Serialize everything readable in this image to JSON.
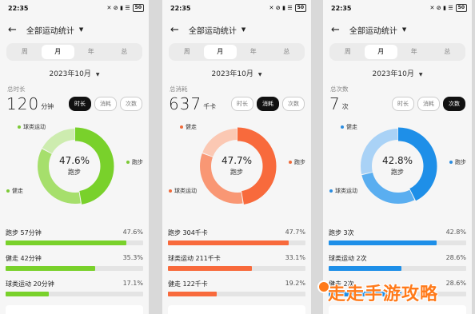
{
  "screens": [
    {
      "status": {
        "time": "22:35",
        "icons": "✕ ⊘ ▮ ☰",
        "battery": "50"
      },
      "header": {
        "title": "全部运动统计"
      },
      "periods": [
        "周",
        "月",
        "年",
        "总"
      ],
      "active_period": 1,
      "date": "2023年10月",
      "metric": {
        "label": "总时长",
        "value": "120",
        "unit": "分钟"
      },
      "toggles": [
        "时长",
        "消耗",
        "次数"
      ],
      "active_toggle": 0,
      "donut": {
        "center_pct": "47.6%",
        "center_label": "跑步"
      },
      "legend": [
        {
          "label": "球类运动",
          "side": "left"
        },
        {
          "label": "健走",
          "side": "left"
        },
        {
          "label": "跑步",
          "side": "right"
        }
      ],
      "colors": {
        "main": "#79d12b",
        "mid": "#a6df6c",
        "light": "#cdecaf",
        "dot": "#7cc936"
      },
      "chart_data": {
        "type": "pie",
        "slices": [
          {
            "name": "跑步",
            "value": 47.6
          },
          {
            "name": "健走",
            "value": 35.3
          },
          {
            "name": "球类运动",
            "value": 17.1
          }
        ]
      },
      "rows": [
        {
          "label": "跑步 57分钟",
          "value": "47.6%",
          "fraction": 0.476
        },
        {
          "label": "健走 42分钟",
          "value": "35.3%",
          "fraction": 0.353
        },
        {
          "label": "球类运动 20分钟",
          "value": "17.1%",
          "fraction": 0.171
        }
      ]
    },
    {
      "status": {
        "time": "22:35",
        "icons": "✕ ⊘ ▮ ☰",
        "battery": "50"
      },
      "header": {
        "title": "全部运动统计"
      },
      "periods": [
        "周",
        "月",
        "年",
        "总"
      ],
      "active_period": 1,
      "date": "2023年10月",
      "metric": {
        "label": "总消耗",
        "value": "637",
        "unit": "千卡"
      },
      "toggles": [
        "时长",
        "消耗",
        "次数"
      ],
      "active_toggle": 1,
      "donut": {
        "center_pct": "47.7%",
        "center_label": "跑步"
      },
      "legend": [
        {
          "label": "健走",
          "side": "left"
        },
        {
          "label": "球类运动",
          "side": "left"
        },
        {
          "label": "跑步",
          "side": "right"
        }
      ],
      "colors": {
        "main": "#f86a3c",
        "mid": "#f99774",
        "light": "#fbc8b3",
        "dot": "#ef6a3a"
      },
      "chart_data": {
        "type": "pie",
        "slices": [
          {
            "name": "跑步",
            "value": 47.7
          },
          {
            "name": "球类运动",
            "value": 33.1
          },
          {
            "name": "健走",
            "value": 19.2
          }
        ]
      },
      "rows": [
        {
          "label": "跑步 304千卡",
          "value": "47.7%",
          "fraction": 0.477
        },
        {
          "label": "球类运动 211千卡",
          "value": "33.1%",
          "fraction": 0.331
        },
        {
          "label": "健走 122千卡",
          "value": "19.2%",
          "fraction": 0.192
        }
      ]
    },
    {
      "status": {
        "time": "22:35",
        "icons": "✕ ⊘ ▮ ☰",
        "battery": "50"
      },
      "header": {
        "title": "全部运动统计"
      },
      "periods": [
        "周",
        "月",
        "年",
        "总"
      ],
      "active_period": 1,
      "date": "2023年10月",
      "metric": {
        "label": "总次数",
        "value": "7",
        "unit": "次"
      },
      "toggles": [
        "时长",
        "消耗",
        "次数"
      ],
      "active_toggle": 2,
      "donut": {
        "center_pct": "42.8%",
        "center_label": "跑步"
      },
      "legend": [
        {
          "label": "健走",
          "side": "left"
        },
        {
          "label": "球类运动",
          "side": "left"
        },
        {
          "label": "跑步",
          "side": "right"
        }
      ],
      "colors": {
        "main": "#1e8fe8",
        "mid": "#5aaef0",
        "light": "#a9d2f6",
        "dot": "#2b8de0"
      },
      "chart_data": {
        "type": "pie",
        "slices": [
          {
            "name": "跑步",
            "value": 42.8
          },
          {
            "name": "球类运动",
            "value": 28.6
          },
          {
            "name": "健走",
            "value": 28.6
          }
        ]
      },
      "rows": [
        {
          "label": "跑步 3次",
          "value": "42.8%",
          "fraction": 0.428
        },
        {
          "label": "球类运动 2次",
          "value": "28.6%",
          "fraction": 0.286
        },
        {
          "label": "健走 2次",
          "value": "28.6%",
          "fraction": 0.286
        }
      ]
    }
  ],
  "watermark": {
    "text": "走走手游攻略"
  }
}
